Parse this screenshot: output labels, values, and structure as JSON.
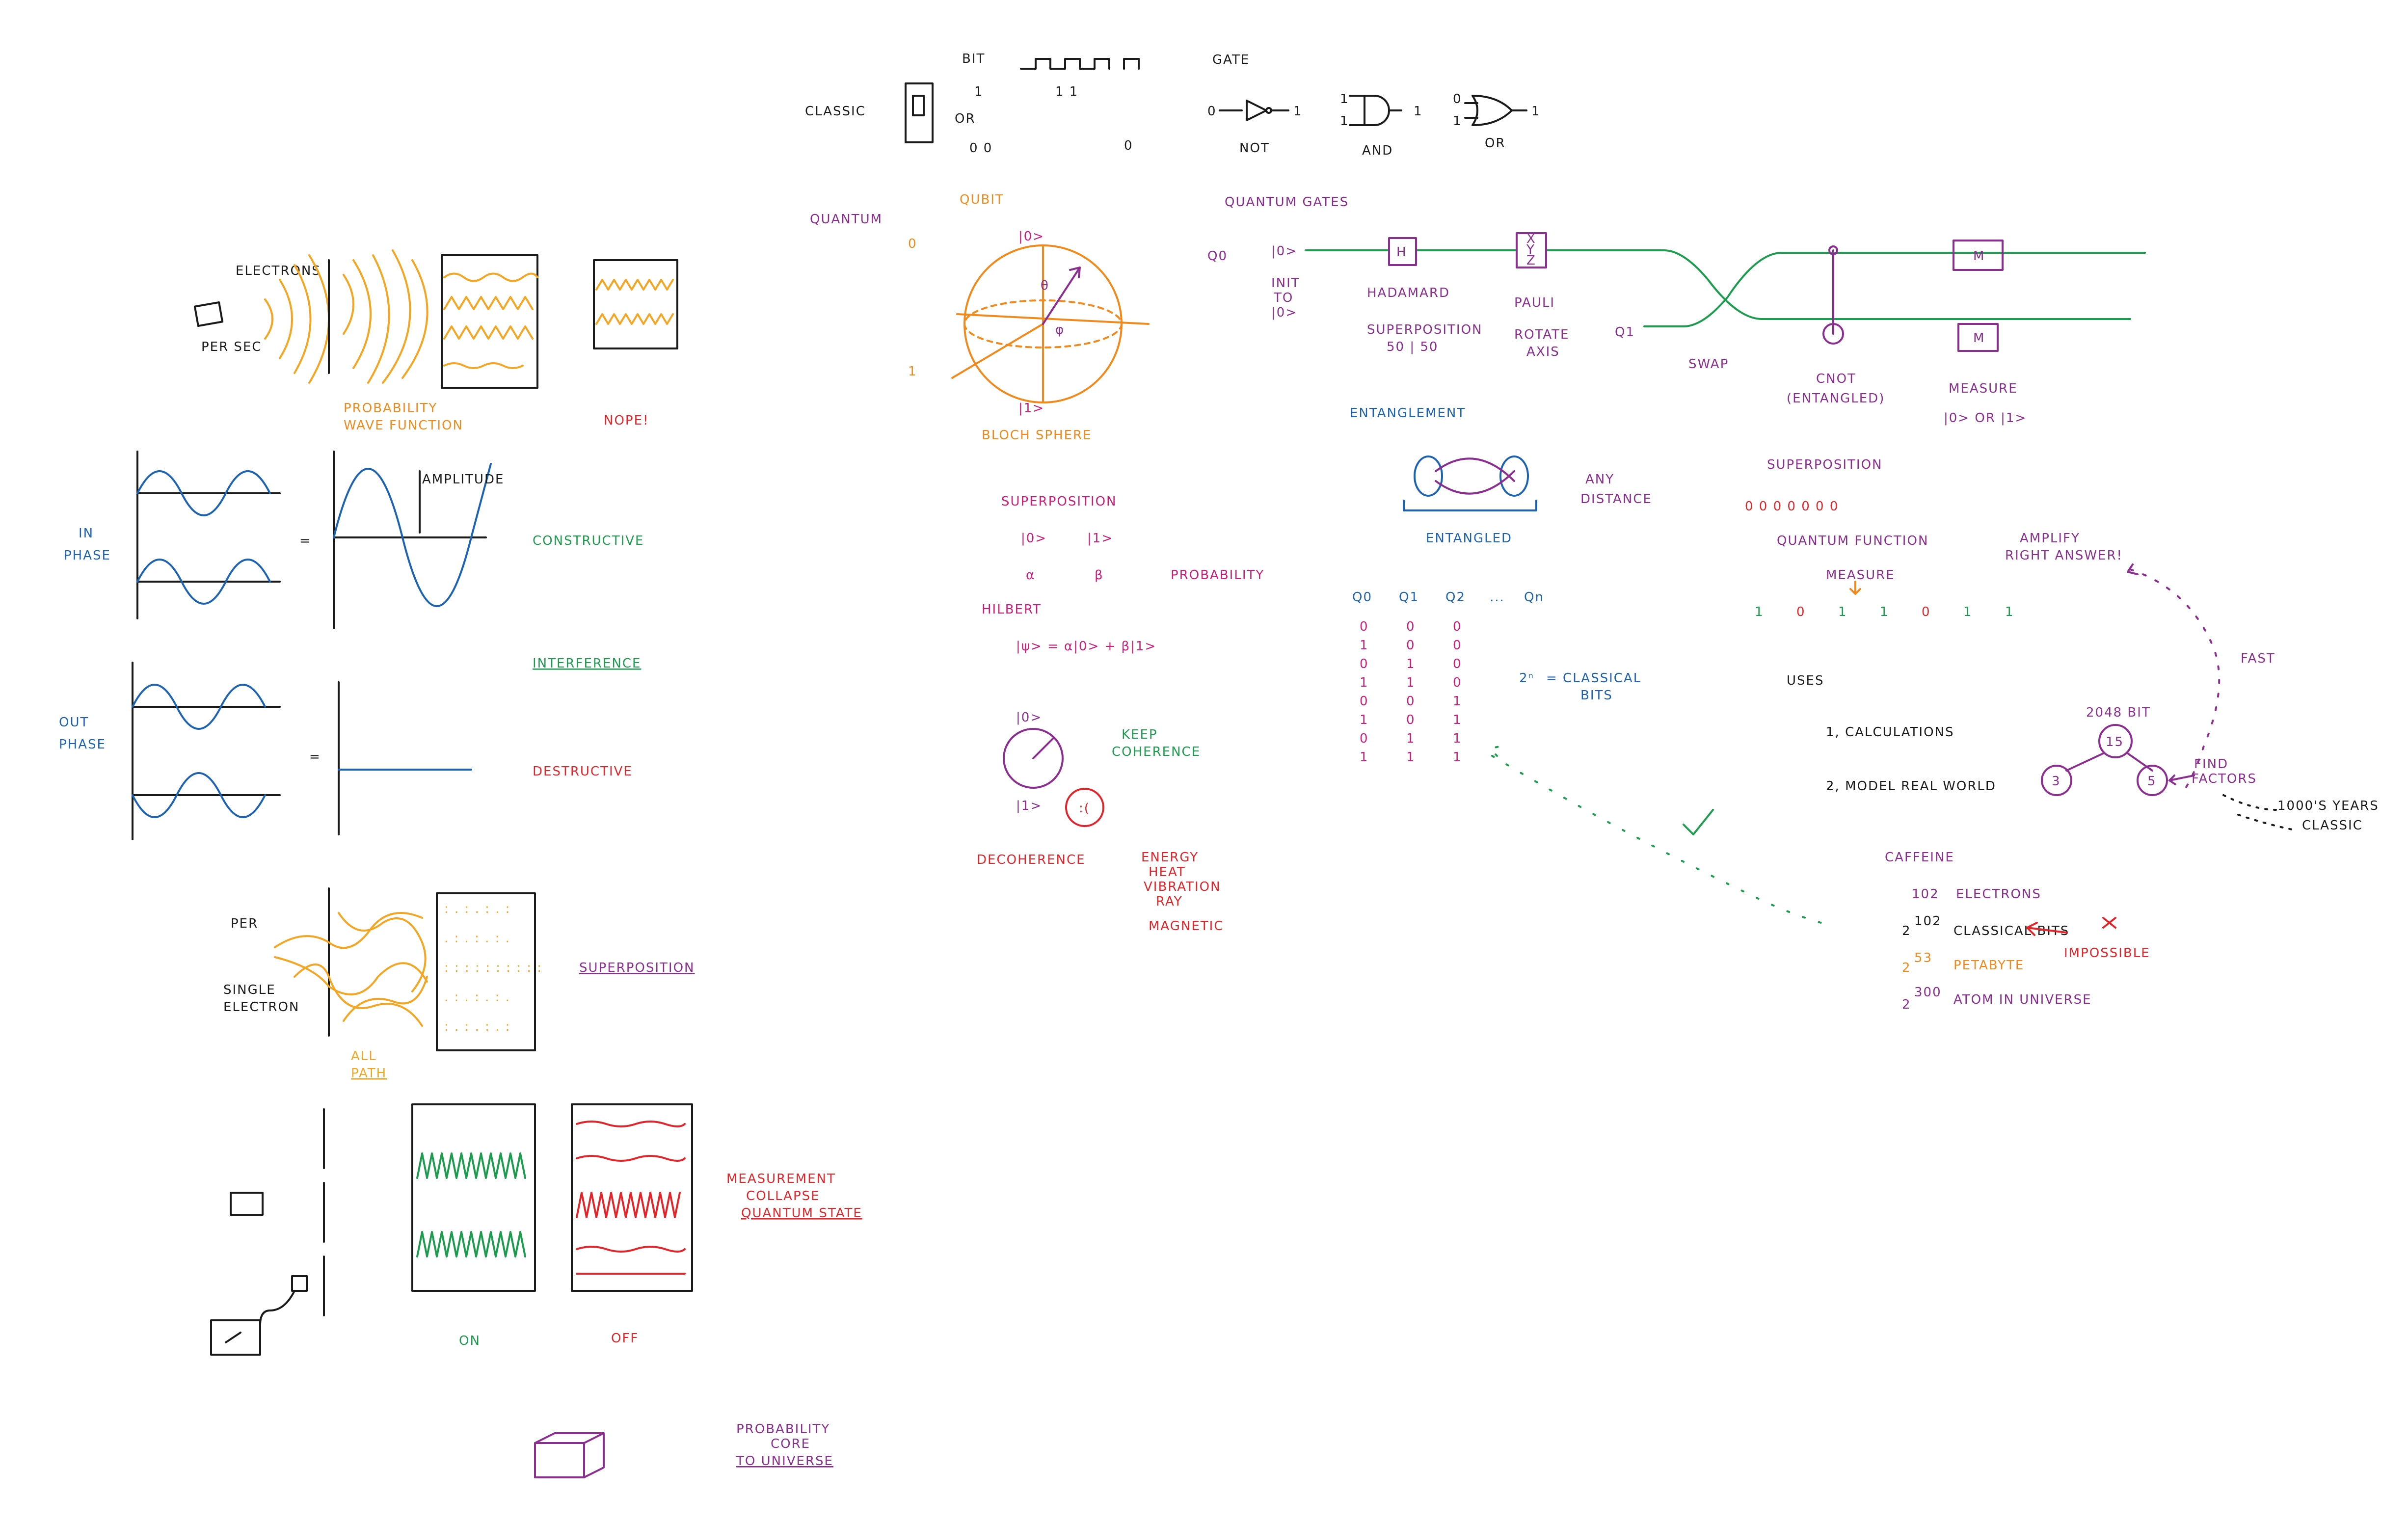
{
  "labels": {
    "bit": "BIT",
    "classic": "CLASSIC",
    "or_small": "OR",
    "gate": "GATE",
    "not": "NOT",
    "and": "AND",
    "or": "OR",
    "quantum": "QUANTUM",
    "qubit": "QUBIT",
    "zero_side": "0",
    "one_side": "1",
    "ket0": "|0>",
    "ket1": "|1>",
    "bloch_sphere": "BLOCH SPHERE",
    "electrons": "ELECTRONS",
    "per_sec": "PER SEC",
    "probability_wave_function": [
      "PROBABILITY",
      "WAVE FUNCTION"
    ],
    "nope": "NOPE!",
    "in_phase": [
      "IN",
      "PHASE"
    ],
    "amplitude": "AMPLITUDE",
    "constructive": "CONSTRUCTIVE",
    "interference": "INTERFERENCE",
    "out_phase": [
      "OUT",
      "PHASE"
    ],
    "destructive": "DESTRUCTIVE",
    "per": "PER",
    "single_electron": [
      "SINGLE",
      "ELECTRON"
    ],
    "all_path": [
      "ALL",
      "PATH"
    ],
    "superposition_left": "SUPERPOSITION",
    "measurement": [
      "MEASUREMENT",
      "COLLAPSE",
      "QUANTUM STATE"
    ],
    "on": "ON",
    "off": "OFF",
    "probability_core": [
      "PROBABILITY",
      "CORE",
      "TO UNIVERSE"
    ],
    "quantum_gates": "QUANTUM GATES",
    "q0": "Q0",
    "q1": "Q1",
    "init": [
      "INIT",
      "TO",
      "|0>"
    ],
    "h": "H",
    "hadamard": "HADAMARD",
    "superposition_5050": [
      "SUPERPOSITION",
      "50 | 50"
    ],
    "pauli": [
      "PAULI",
      "ROTATE",
      "AXIS"
    ],
    "pauli_box": [
      "X",
      "Y",
      "Z"
    ],
    "swap": "SWAP",
    "cnot": [
      "CNOT",
      "(ENTANGLED)"
    ],
    "m": "M",
    "measure": [
      "MEASURE",
      "|0> OR |1>"
    ],
    "superposition_mid": "SUPERPOSITION",
    "ket_alpha_row": [
      "|0>",
      "|1>"
    ],
    "alpha": "α",
    "beta": "β",
    "probability": "PROBABILITY",
    "hilbert": "HILBERT",
    "psi_eq": "|ψ> = α|0> + β|1>",
    "keep_coherence": [
      "KEEP",
      "COHERENCE"
    ],
    "decoherence": "DECOHERENCE",
    "energy_list": [
      "ENERGY",
      "HEAT",
      "VIBRATION",
      "RAY",
      "MAGNETIC"
    ],
    "entanglement": "ENTANGLEMENT",
    "entangled": "ENTANGLED",
    "any_distance": [
      "ANY",
      "DISTANCE"
    ],
    "qubits_header": [
      "Q0",
      "Q1",
      "Q2",
      "...",
      "Qn"
    ],
    "qubit_columns": [
      [
        "0",
        "1",
        "0",
        "1",
        "0",
        "1",
        "0",
        "1"
      ],
      [
        "0",
        "0",
        "1",
        "1",
        "0",
        "0",
        "1",
        "1"
      ],
      [
        "0",
        "0",
        "0",
        "0",
        "1",
        "1",
        "1",
        "1"
      ]
    ],
    "two_n": "2ⁿ",
    "classical_bits": [
      "= CLASSICAL",
      "BITS"
    ],
    "superposition_right": "SUPERPOSITION",
    "quantum_function": "QUANTUM FUNCTION",
    "amplify": [
      "AMPLIFY",
      "RIGHT ANSWER!"
    ],
    "measure_small": "MEASURE",
    "measure_bits": [
      "1",
      "0",
      "1",
      "1",
      "0",
      "1",
      "1"
    ],
    "fast": "FAST",
    "uses": "USES",
    "uses_list": [
      "1, CALCULATIONS",
      "2, MODEL REAL WORLD"
    ],
    "bit_2048": "2048 BIT",
    "tree": [
      "15",
      "3",
      "5"
    ],
    "find_factors": [
      "FIND",
      "FACTORS"
    ],
    "classic_years": [
      "1000'S YEARS",
      "CLASSIC"
    ],
    "caffeine": "CAFFEINE",
    "caffeine_rows": [
      {
        "base": "102",
        "sup": "",
        "text": "ELECTRONS"
      },
      {
        "base": "2",
        "sup": "102",
        "text": "CLASSICAL BITS"
      },
      {
        "base": "2",
        "sup": "53",
        "text": "PETABYTE"
      },
      {
        "base": "2",
        "sup": "300",
        "text": "ATOM IN UNIVERSE"
      }
    ],
    "impossible": "IMPOSSIBLE"
  },
  "colors": {
    "black": "#1a1a1a",
    "orange": "#f08a1c",
    "yellow": "#f2a623",
    "blue": "#1e63b0",
    "green": "#1d9b4e",
    "red": "#e0262b",
    "purple": "#8a2f8f",
    "magenta": "#c8207a"
  }
}
